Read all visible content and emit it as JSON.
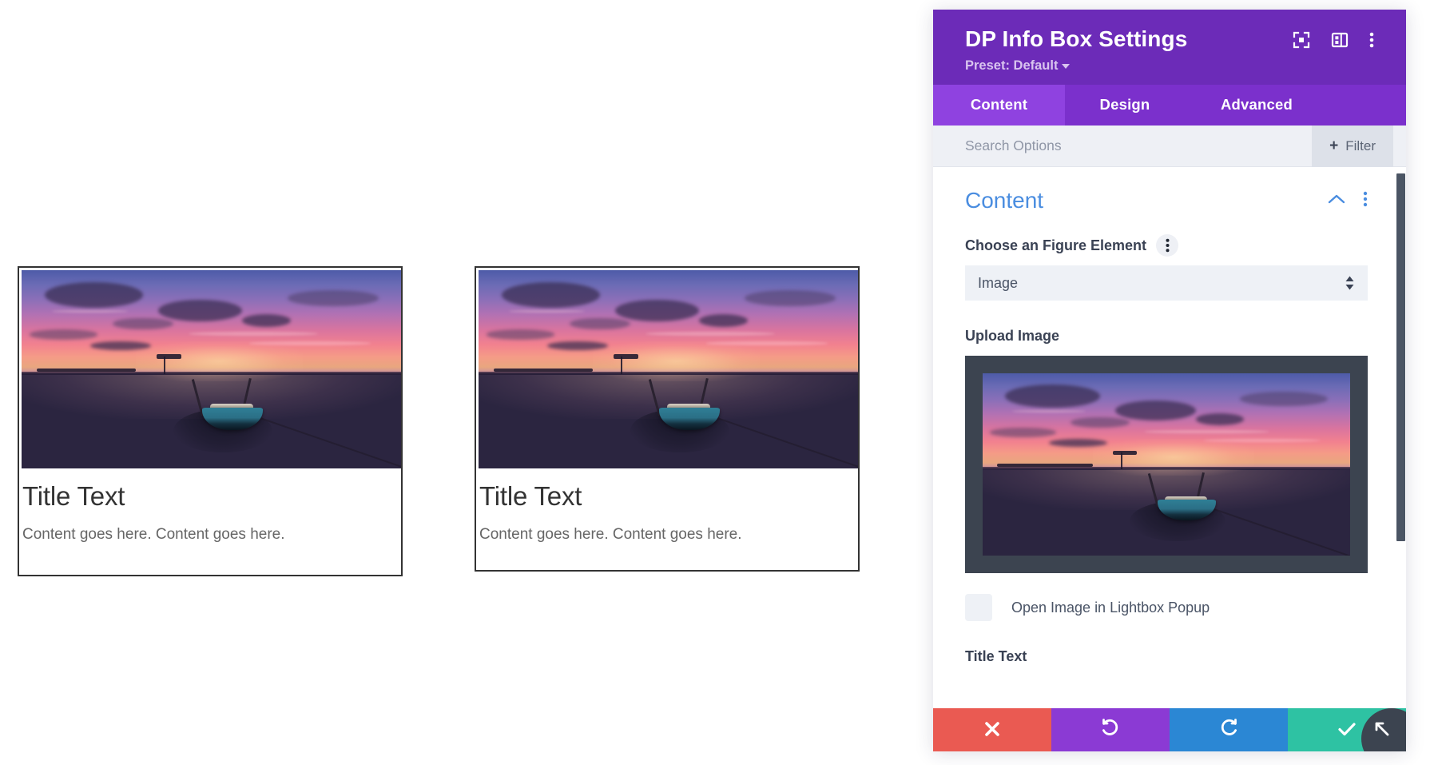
{
  "canvas": {
    "infoboxes": [
      {
        "name": "info-box-left",
        "title": "Title Text",
        "content": "Content goes here. Content goes here.",
        "image_alt": "sunset-boat-photo"
      },
      {
        "name": "info-box-right",
        "title": "Title Text",
        "content": "Content goes here. Content goes here.",
        "image_alt": "sunset-boat-photo"
      }
    ]
  },
  "panel": {
    "header": {
      "title": "DP Info Box Settings",
      "preset_label": "Preset: Default",
      "icons": [
        "focus-target-icon",
        "layout-panel-icon",
        "more-vertical-icon"
      ]
    },
    "tabs": [
      {
        "label": "Content",
        "active": true
      },
      {
        "label": "Design",
        "active": false
      },
      {
        "label": "Advanced",
        "active": false
      }
    ],
    "search": {
      "placeholder": "Search Options",
      "value": "",
      "filter_label": "Filter",
      "filter_plus": "+"
    },
    "section": {
      "title": "Content",
      "collapse_icon": "chevron-up-icon",
      "menu_icon": "more-vertical-icon"
    },
    "fields": {
      "figure_element_label": "Choose an Figure Element",
      "figure_element_value": "Image",
      "figure_element_options": [
        "Image"
      ],
      "upload_image_label": "Upload Image",
      "lightbox_checkbox_label": "Open Image in Lightbox Popup",
      "lightbox_checked": false,
      "next_field_label": "Title Text"
    },
    "footer": {
      "cancel_label": "cancel-icon",
      "undo_label": "undo-icon",
      "redo_label": "redo-icon",
      "save_label": "check-icon"
    },
    "resize_handle": "resize-arrow-icon"
  },
  "colors": {
    "header_purple": "#6c2bb8",
    "tab_bar_purple": "#7b30cc",
    "tab_active_purple": "#8f42e0",
    "section_title_blue": "#4a8de0",
    "cancel_red": "#ea5a52",
    "undo_purple": "#8b3ad4",
    "redo_blue": "#2b87d4",
    "save_green": "#2ec2a3",
    "scrollbar_dark": "#4b5564"
  }
}
